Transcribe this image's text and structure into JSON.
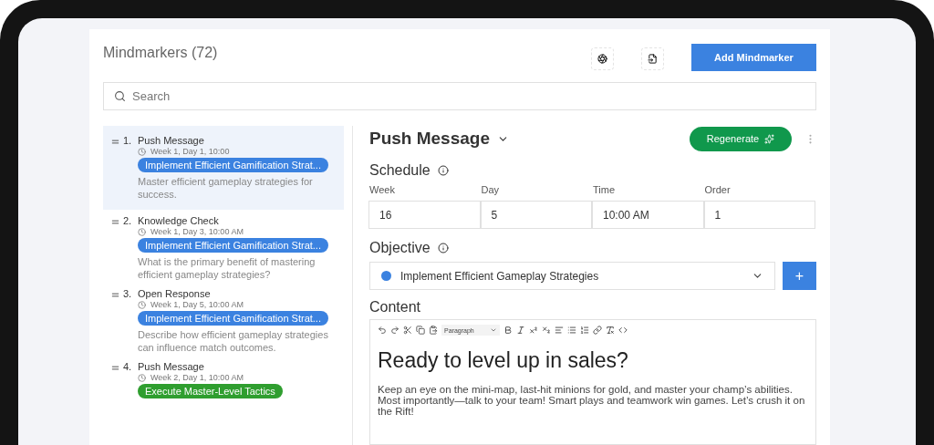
{
  "header": {
    "title": "Mindmarkers (72)",
    "add_button": "Add Mindmarker"
  },
  "search": {
    "placeholder": "Search"
  },
  "items": [
    {
      "number": "1.",
      "type": "Push Message",
      "schedule": "Week 1, Day 1, 10:00",
      "tag": {
        "label": "Implement Efficient Gamification Strat...",
        "color": "#3b82e0"
      },
      "description": "Master efficient gameplay strategies for success.",
      "selected": true
    },
    {
      "number": "2.",
      "type": "Knowledge Check",
      "schedule": "Week 1, Day 3, 10:00 AM",
      "tag": {
        "label": "Implement Efficient Gamification Strat...",
        "color": "#3b82e0"
      },
      "description": "What is the primary benefit of mastering efficient gameplay strategies?",
      "selected": false
    },
    {
      "number": "3.",
      "type": "Open Response",
      "schedule": "Week 1, Day 5, 10:00 AM",
      "tag": {
        "label": "Implement Efficient Gamification Strat...",
        "color": "#3b82e0"
      },
      "description": "Describe how efficient gameplay strategies can influence match outcomes.",
      "selected": false
    },
    {
      "number": "4.",
      "type": "Push Message",
      "schedule": "Week 2, Day 1, 10:00 AM",
      "tag": {
        "label": "Execute Master-Level Tactics",
        "color": "#2f9e2f"
      },
      "selected": false
    }
  ],
  "detail": {
    "type": "Push Message",
    "regenerate_button": "Regenerate",
    "schedule": {
      "label": "Schedule",
      "fields": [
        {
          "label": "Week",
          "value": "16"
        },
        {
          "label": "Day",
          "value": "5"
        },
        {
          "label": "Time",
          "value": "10:00 AM"
        },
        {
          "label": "Order",
          "value": "1"
        }
      ]
    },
    "objective": {
      "label": "Objective",
      "value": "Implement Efficient Gameplay Strategies",
      "color": "#3b82e0",
      "add_button": "+"
    },
    "content": {
      "label": "Content",
      "block_format": "Paragraph",
      "heading": "Ready to level up in sales?",
      "body": "Keep an eye on the mini-map, last-hit minions for gold, and master your champ’s abilities. Most importantly—talk to your team! Smart plays and teamwork win games. Let’s crush it on the Rift!"
    }
  }
}
